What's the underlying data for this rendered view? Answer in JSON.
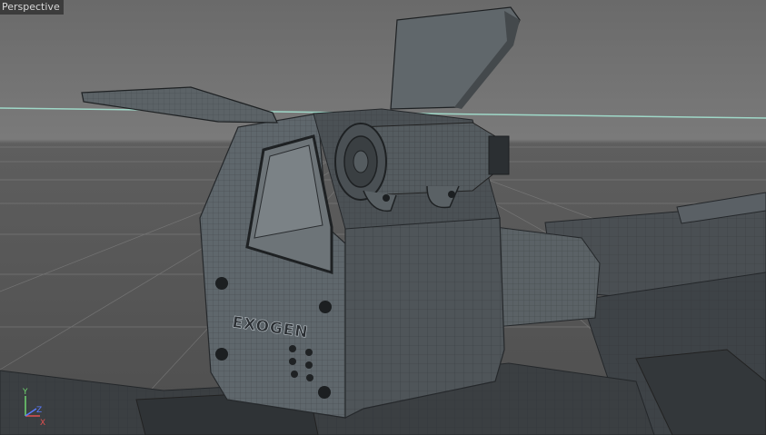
{
  "viewport": {
    "camera_label": "Perspective",
    "model_engraving": "EXOGEN",
    "axis_gizmo": {
      "y": "Y",
      "x": "X",
      "z": "Z"
    },
    "colors": {
      "horizon_line": "#9fd8c8",
      "axis_y": "#6fd36f",
      "axis_x": "#e05050",
      "axis_z": "#5a7bff",
      "model": "#4f5559",
      "wire": "#2a2d30"
    }
  }
}
